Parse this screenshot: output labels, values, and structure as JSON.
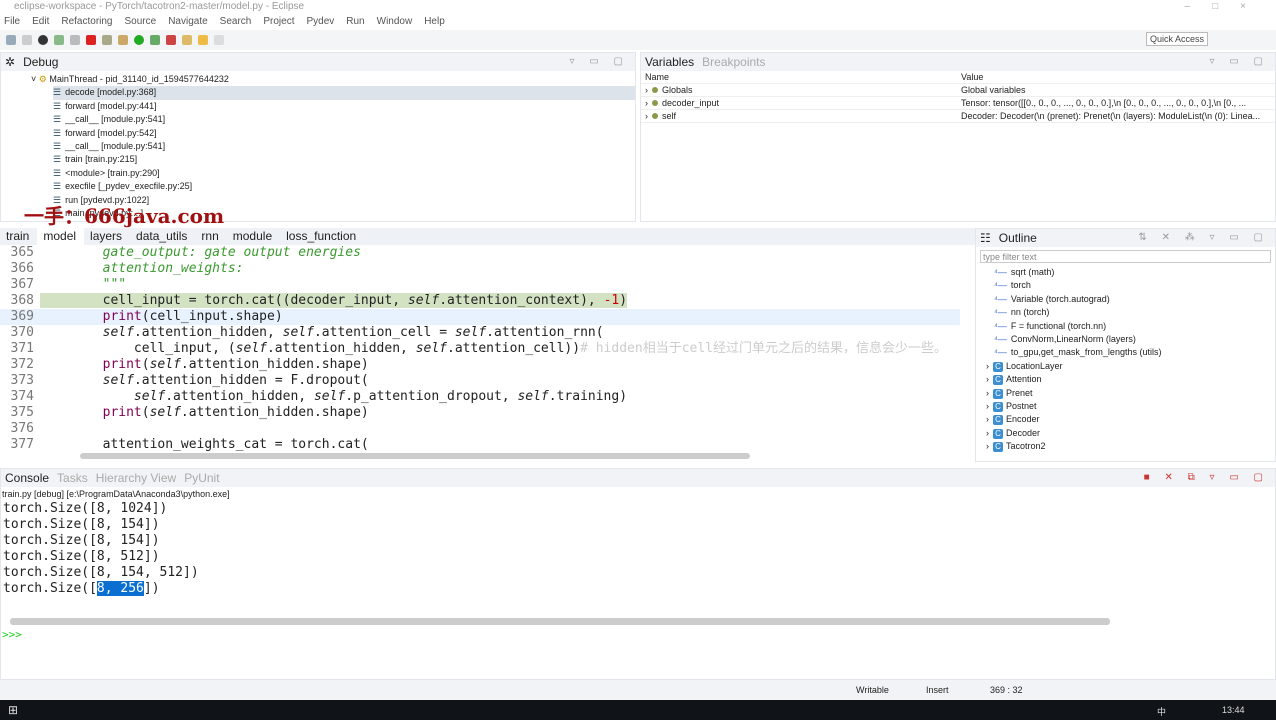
{
  "window": {
    "title": "eclipse-workspace - PyTorch/tacotron2-master/model.py - Eclipse"
  },
  "menu": [
    "File",
    "Edit",
    "Refactoring",
    "Source",
    "Navigate",
    "Search",
    "Project",
    "Pydev",
    "Run",
    "Window",
    "Help"
  ],
  "toolbar": {
    "quick_access": "Quick Access"
  },
  "debug": {
    "title": "Debug",
    "thread": "MainThread - pid_31140_id_1594577644232",
    "frames": [
      "decode [model.py:368]",
      "forward [model.py:441]",
      "__call__ [module.py:541]",
      "forward [model.py:542]",
      "__call__ [module.py:541]",
      "train [train.py:215]",
      "<module> [train.py:290]",
      "execfile [_pydev_execfile.py:25]",
      "run [pydevd.py:1022]",
      "main [pydevd.py:...]"
    ]
  },
  "variables": {
    "tab": "Variables",
    "tab2": "Breakpoints",
    "col_name": "Name",
    "col_value": "Value",
    "rows": [
      {
        "name": "Globals",
        "value": "Global variables"
      },
      {
        "name": "decoder_input",
        "value": "Tensor: tensor([[0., 0., 0.,  ..., 0., 0., 0.],\\n        [0., 0., 0.,  ..., 0., 0., 0.],\\n        [0., ..."
      },
      {
        "name": "self",
        "value": "Decoder: Decoder(\\n  (prenet): Prenet(\\n    (layers): ModuleList(\\n      (0): Linea..."
      }
    ]
  },
  "editor": {
    "tabs": [
      "train",
      "model",
      "layers",
      "data_utils",
      "rnn",
      "module",
      "loss_function"
    ],
    "active_tab": "model",
    "lines": [
      {
        "no": "365",
        "tokens": [
          [
            "        gate_output: gate output energies",
            "doc"
          ]
        ]
      },
      {
        "no": "366",
        "tokens": [
          [
            "        attention_weights:",
            "doc"
          ]
        ]
      },
      {
        "no": "367",
        "tokens": [
          [
            "        \"\"\"",
            "doc"
          ]
        ]
      },
      {
        "no": "368",
        "hl": true,
        "tokens": [
          [
            "        ",
            ""
          ],
          [
            "cell_input = torch.cat((decoder_input, ",
            ""
          ],
          [
            "self",
            "s"
          ],
          [
            ".attention_context), ",
            ""
          ],
          [
            "-1",
            "n"
          ],
          [
            ")",
            ""
          ]
        ]
      },
      {
        "no": "369",
        "cur": true,
        "tokens": [
          [
            "        ",
            ""
          ],
          [
            "print",
            "p"
          ],
          [
            "(cell_input.shape)",
            ""
          ]
        ]
      },
      {
        "no": "370",
        "tokens": [
          [
            "        ",
            ""
          ],
          [
            "self",
            "s"
          ],
          [
            ".attention_hidden, ",
            ""
          ],
          [
            "self",
            "s"
          ],
          [
            ".attention_cell = ",
            ""
          ],
          [
            "self",
            "s"
          ],
          [
            ".attention_rnn(",
            ""
          ]
        ]
      },
      {
        "no": "371",
        "tokens": [
          [
            "            cell_input, (",
            ""
          ],
          [
            "self",
            "s"
          ],
          [
            ".attention_hidden, ",
            ""
          ],
          [
            "self",
            "s"
          ],
          [
            ".attention_cell))",
            ""
          ],
          [
            "# hidden相当于cell经过门单元之后的结果，信息会少一些。",
            "cm"
          ]
        ]
      },
      {
        "no": "372",
        "tokens": [
          [
            "        ",
            ""
          ],
          [
            "print",
            "p"
          ],
          [
            "(",
            ""
          ],
          [
            "self",
            "s"
          ],
          [
            ".attention_hidden.shape)",
            ""
          ]
        ]
      },
      {
        "no": "373",
        "tokens": [
          [
            "        ",
            ""
          ],
          [
            "self",
            "s"
          ],
          [
            ".attention_hidden = F.dropout(",
            ""
          ]
        ]
      },
      {
        "no": "374",
        "tokens": [
          [
            "            ",
            ""
          ],
          [
            "self",
            "s"
          ],
          [
            ".attention_hidden, ",
            ""
          ],
          [
            "self",
            "s"
          ],
          [
            ".p_attention_dropout, ",
            ""
          ],
          [
            "self",
            "s"
          ],
          [
            ".training)",
            ""
          ]
        ]
      },
      {
        "no": "375",
        "tokens": [
          [
            "        ",
            ""
          ],
          [
            "print",
            "p"
          ],
          [
            "(",
            ""
          ],
          [
            "self",
            "s"
          ],
          [
            ".attention_hidden.shape)",
            ""
          ]
        ]
      },
      {
        "no": "376",
        "tokens": [
          [
            "",
            ""
          ]
        ]
      },
      {
        "no": "377",
        "tokens": [
          [
            "        attention_weights_cat = torch.cat(",
            ""
          ]
        ]
      }
    ]
  },
  "outline": {
    "title": "Outline",
    "filter_placeholder": "type filter text",
    "imports": [
      "sqrt (math)",
      "torch",
      "Variable (torch.autograd)",
      "nn (torch)",
      "F = functional (torch.nn)",
      "ConvNorm,LinearNorm (layers)",
      "to_gpu,get_mask_from_lengths (utils)"
    ],
    "classes": [
      "LocationLayer",
      "Attention",
      "Prenet",
      "Postnet",
      "Encoder",
      "Decoder",
      "Tacotron2"
    ]
  },
  "console": {
    "tabs": [
      "Console",
      "Tasks",
      "Hierarchy View",
      "PyUnit"
    ],
    "info": "train.py [debug] [e:\\ProgramData\\Anaconda3\\python.exe]",
    "lines": [
      "torch.Size([8, 1024])",
      "torch.Size([8, 154])",
      "torch.Size([8, 154])",
      "torch.Size([8, 512])",
      "torch.Size([8, 154, 512])"
    ],
    "last_prefix": "torch.Size([",
    "last_selected": "8, 256",
    "last_suffix": "])",
    "prompt": ">>>"
  },
  "status": {
    "writable": "Writable",
    "mode": "Insert",
    "position": "369 : 32"
  },
  "taskbar": {
    "ime": "中",
    "clock": "13:44"
  },
  "watermark": "一手：666java.com",
  "colors": {
    "current_line_highlight": "#d4e2c4",
    "selection": "#0b6fd1",
    "docstring": "#3a9a2f"
  }
}
